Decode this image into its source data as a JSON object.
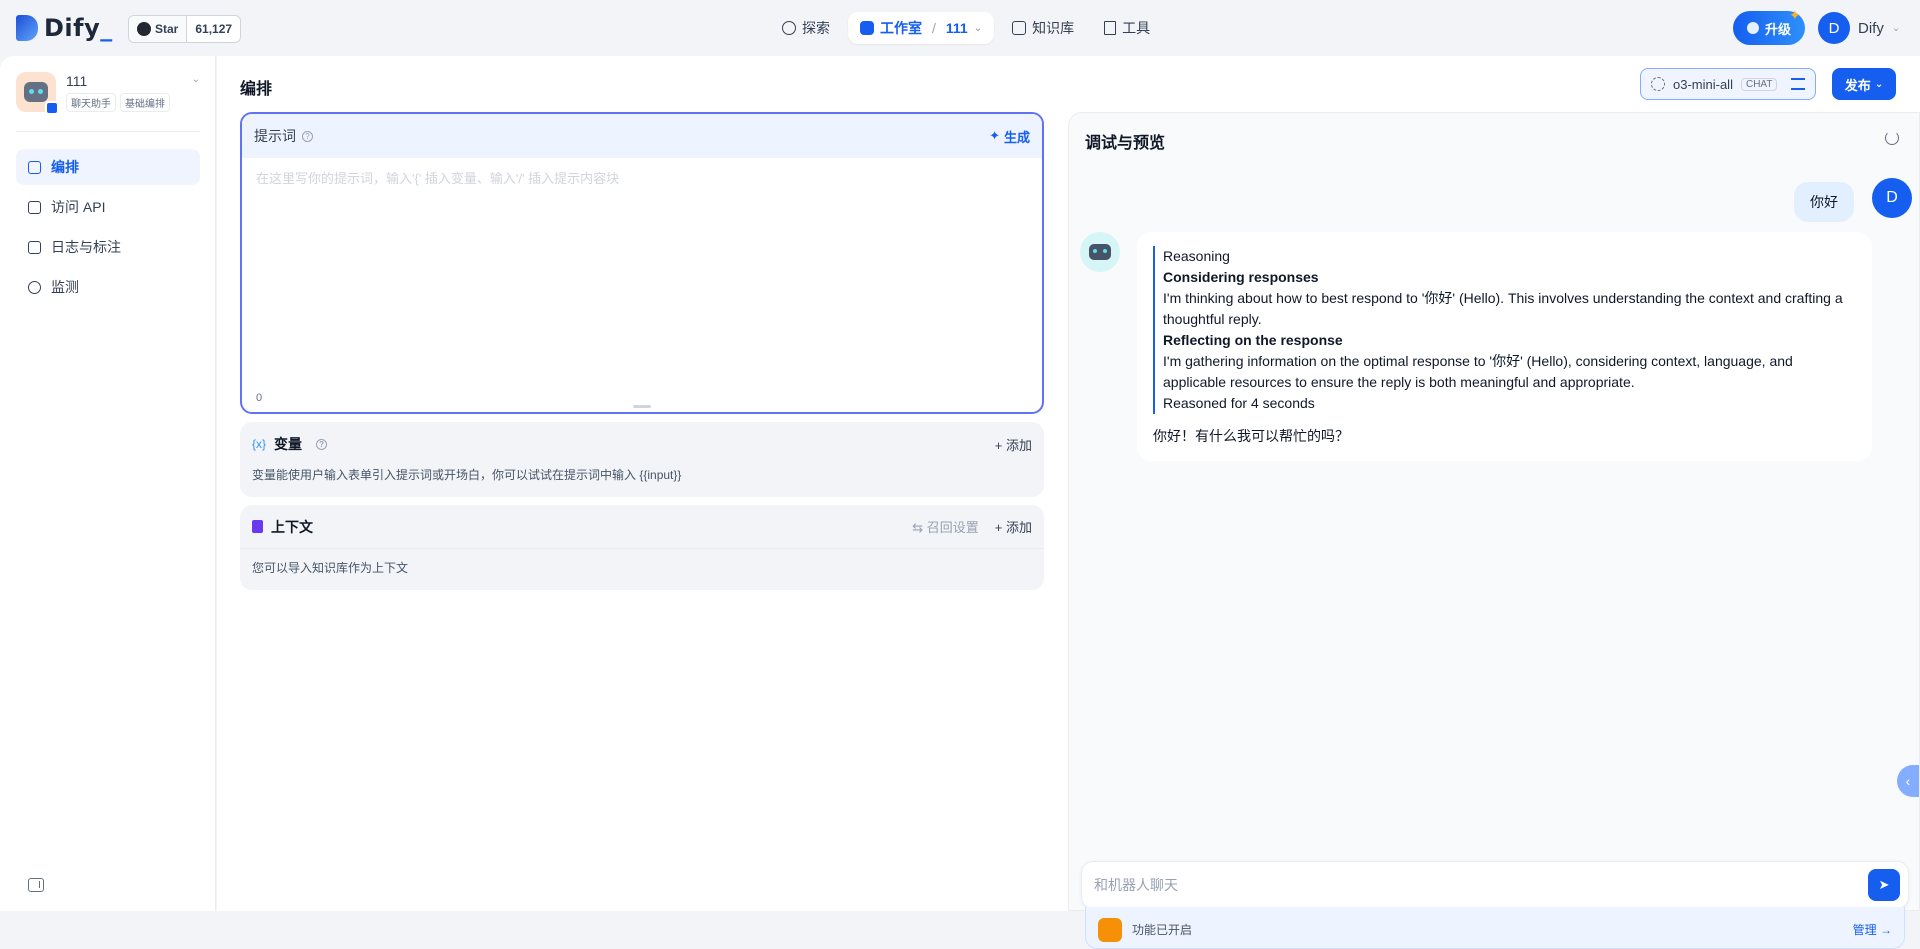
{
  "brand": {
    "name": "Dify",
    "cursor": "_",
    "primary_color": "#155eef"
  },
  "github": {
    "star_label": "Star",
    "count": "61,127"
  },
  "nav": {
    "explore": "探索",
    "studio": "工作室",
    "studio_app": "111",
    "knowledge": "知识库",
    "tools": "工具"
  },
  "account": {
    "upgrade": "升级",
    "avatar_letter": "D",
    "name": "Dify"
  },
  "app": {
    "name": "111",
    "tags": [
      "聊天助手",
      "基础编排"
    ]
  },
  "sidebar": {
    "items": [
      {
        "label": "编排",
        "icon": "layout-icon"
      },
      {
        "label": "访问 API",
        "icon": "terminal-icon"
      },
      {
        "label": "日志与标注",
        "icon": "file-list-icon"
      },
      {
        "label": "监测",
        "icon": "gauge-icon"
      }
    ]
  },
  "main": {
    "title": "编排",
    "model": {
      "name": "o3-mini-all",
      "mode": "CHAT"
    },
    "publish": "发布"
  },
  "prompt": {
    "label": "提示词",
    "generate": "生成",
    "placeholder": "在这里写你的提示词，输入'{' 插入变量、输入'/' 插入提示内容块",
    "count": "0"
  },
  "variables": {
    "icon_text": "{x}",
    "label": "变量",
    "add": "添加",
    "hint": "变量能使用户输入表单引入提示词或开场白，你可以试试在提示词中输入 {{input}}"
  },
  "context": {
    "label": "上下文",
    "recall": "召回设置",
    "add": "添加",
    "hint": "您可以导入知识库作为上下文"
  },
  "debug": {
    "title": "调试与预览",
    "user_message": "你好",
    "user_avatar": "D",
    "reasoning": {
      "label": "Reasoning",
      "h1": "Considering responses",
      "p1": "I'm thinking about how to best respond to '你好' (Hello). This involves understanding the context and crafting a thoughtful reply.",
      "h2": "Reflecting on the response",
      "p2": "I'm gathering information on the optimal response to '你好' (Hello), considering context, language, and applicable resources to ensure the reply is both meaningful and appropriate.",
      "footer": "Reasoned for 4 seconds"
    },
    "answer": "你好！有什么我可以帮忙的吗？",
    "input_placeholder": "和机器人聊天",
    "feature_status": "功能已开启",
    "manage": "管理"
  }
}
